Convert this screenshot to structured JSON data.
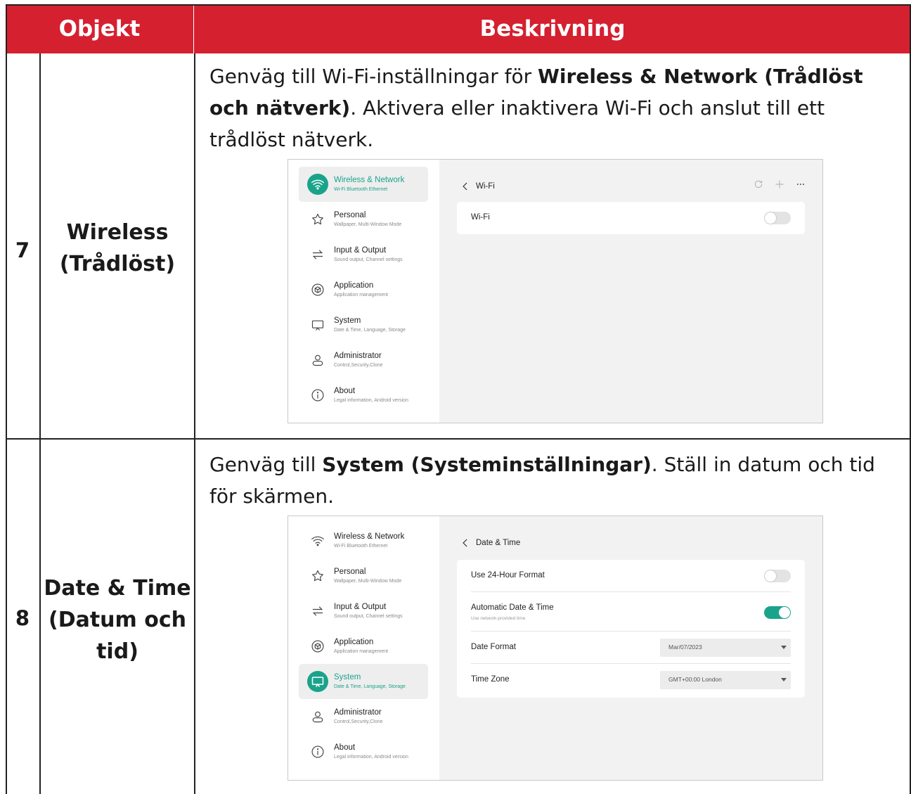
{
  "table": {
    "header_objekt": "Objekt",
    "header_beskrivning": "Beskrivning",
    "colors": {
      "header_bg": "#d52030",
      "accent": "#1aa38b"
    }
  },
  "row7": {
    "number": "7",
    "object_line1": "Wireless",
    "object_line2": "(Trådlöst)",
    "desc_pre": "Genväg till Wi-Fi-inställningar för ",
    "desc_bold": "Wireless & Network (Trådlöst och nätverk)",
    "desc_post": ". Aktivera eller inaktivera Wi-Fi och anslut till ett trådlöst nätverk."
  },
  "row8": {
    "number": "8",
    "object_line1": "Date & Time",
    "object_line2": "(Datum och",
    "object_line3": "tid)",
    "desc_pre": "Genväg till ",
    "desc_bold": "System (Systeminställningar)",
    "desc_post": ". Ställ in datum och tid för skärmen."
  },
  "sidebar": {
    "items": [
      {
        "title": "Wireless & Network",
        "subtitle": "Wi-Fi Bluetooth Ethernet",
        "icon": "wifi-icon"
      },
      {
        "title": "Personal",
        "subtitle": "Wallpaper, Multi-Window Mode",
        "icon": "star-icon"
      },
      {
        "title": "Input & Output",
        "subtitle": "Sound output, Channel settings",
        "icon": "arrows-icon"
      },
      {
        "title": "Application",
        "subtitle": "Application management",
        "icon": "cube-icon"
      },
      {
        "title": "System",
        "subtitle": "Date & Time, Language, Storage",
        "icon": "monitor-icon"
      },
      {
        "title": "Administrator",
        "subtitle": "Control,Security,Clone",
        "icon": "user-icon"
      },
      {
        "title": "About",
        "subtitle": "Legal information, Android version",
        "icon": "info-icon"
      }
    ]
  },
  "wifi_screen": {
    "back_title": "Wi-Fi",
    "wifi_label": "Wi-Fi",
    "wifi_enabled": false,
    "icons": [
      "refresh-icon",
      "plus-icon",
      "more-icon"
    ]
  },
  "datetime_screen": {
    "back_title": "Date & Time",
    "use24_label": "Use 24-Hour Format",
    "use24_enabled": false,
    "auto_label": "Automatic Date & Time",
    "auto_sub": "Use network-provided time",
    "auto_enabled": true,
    "date_format_label": "Date Format",
    "date_format_value": "Mar/07/2023",
    "time_zone_label": "Time Zone",
    "time_zone_value": "GMT+00:00 London"
  }
}
